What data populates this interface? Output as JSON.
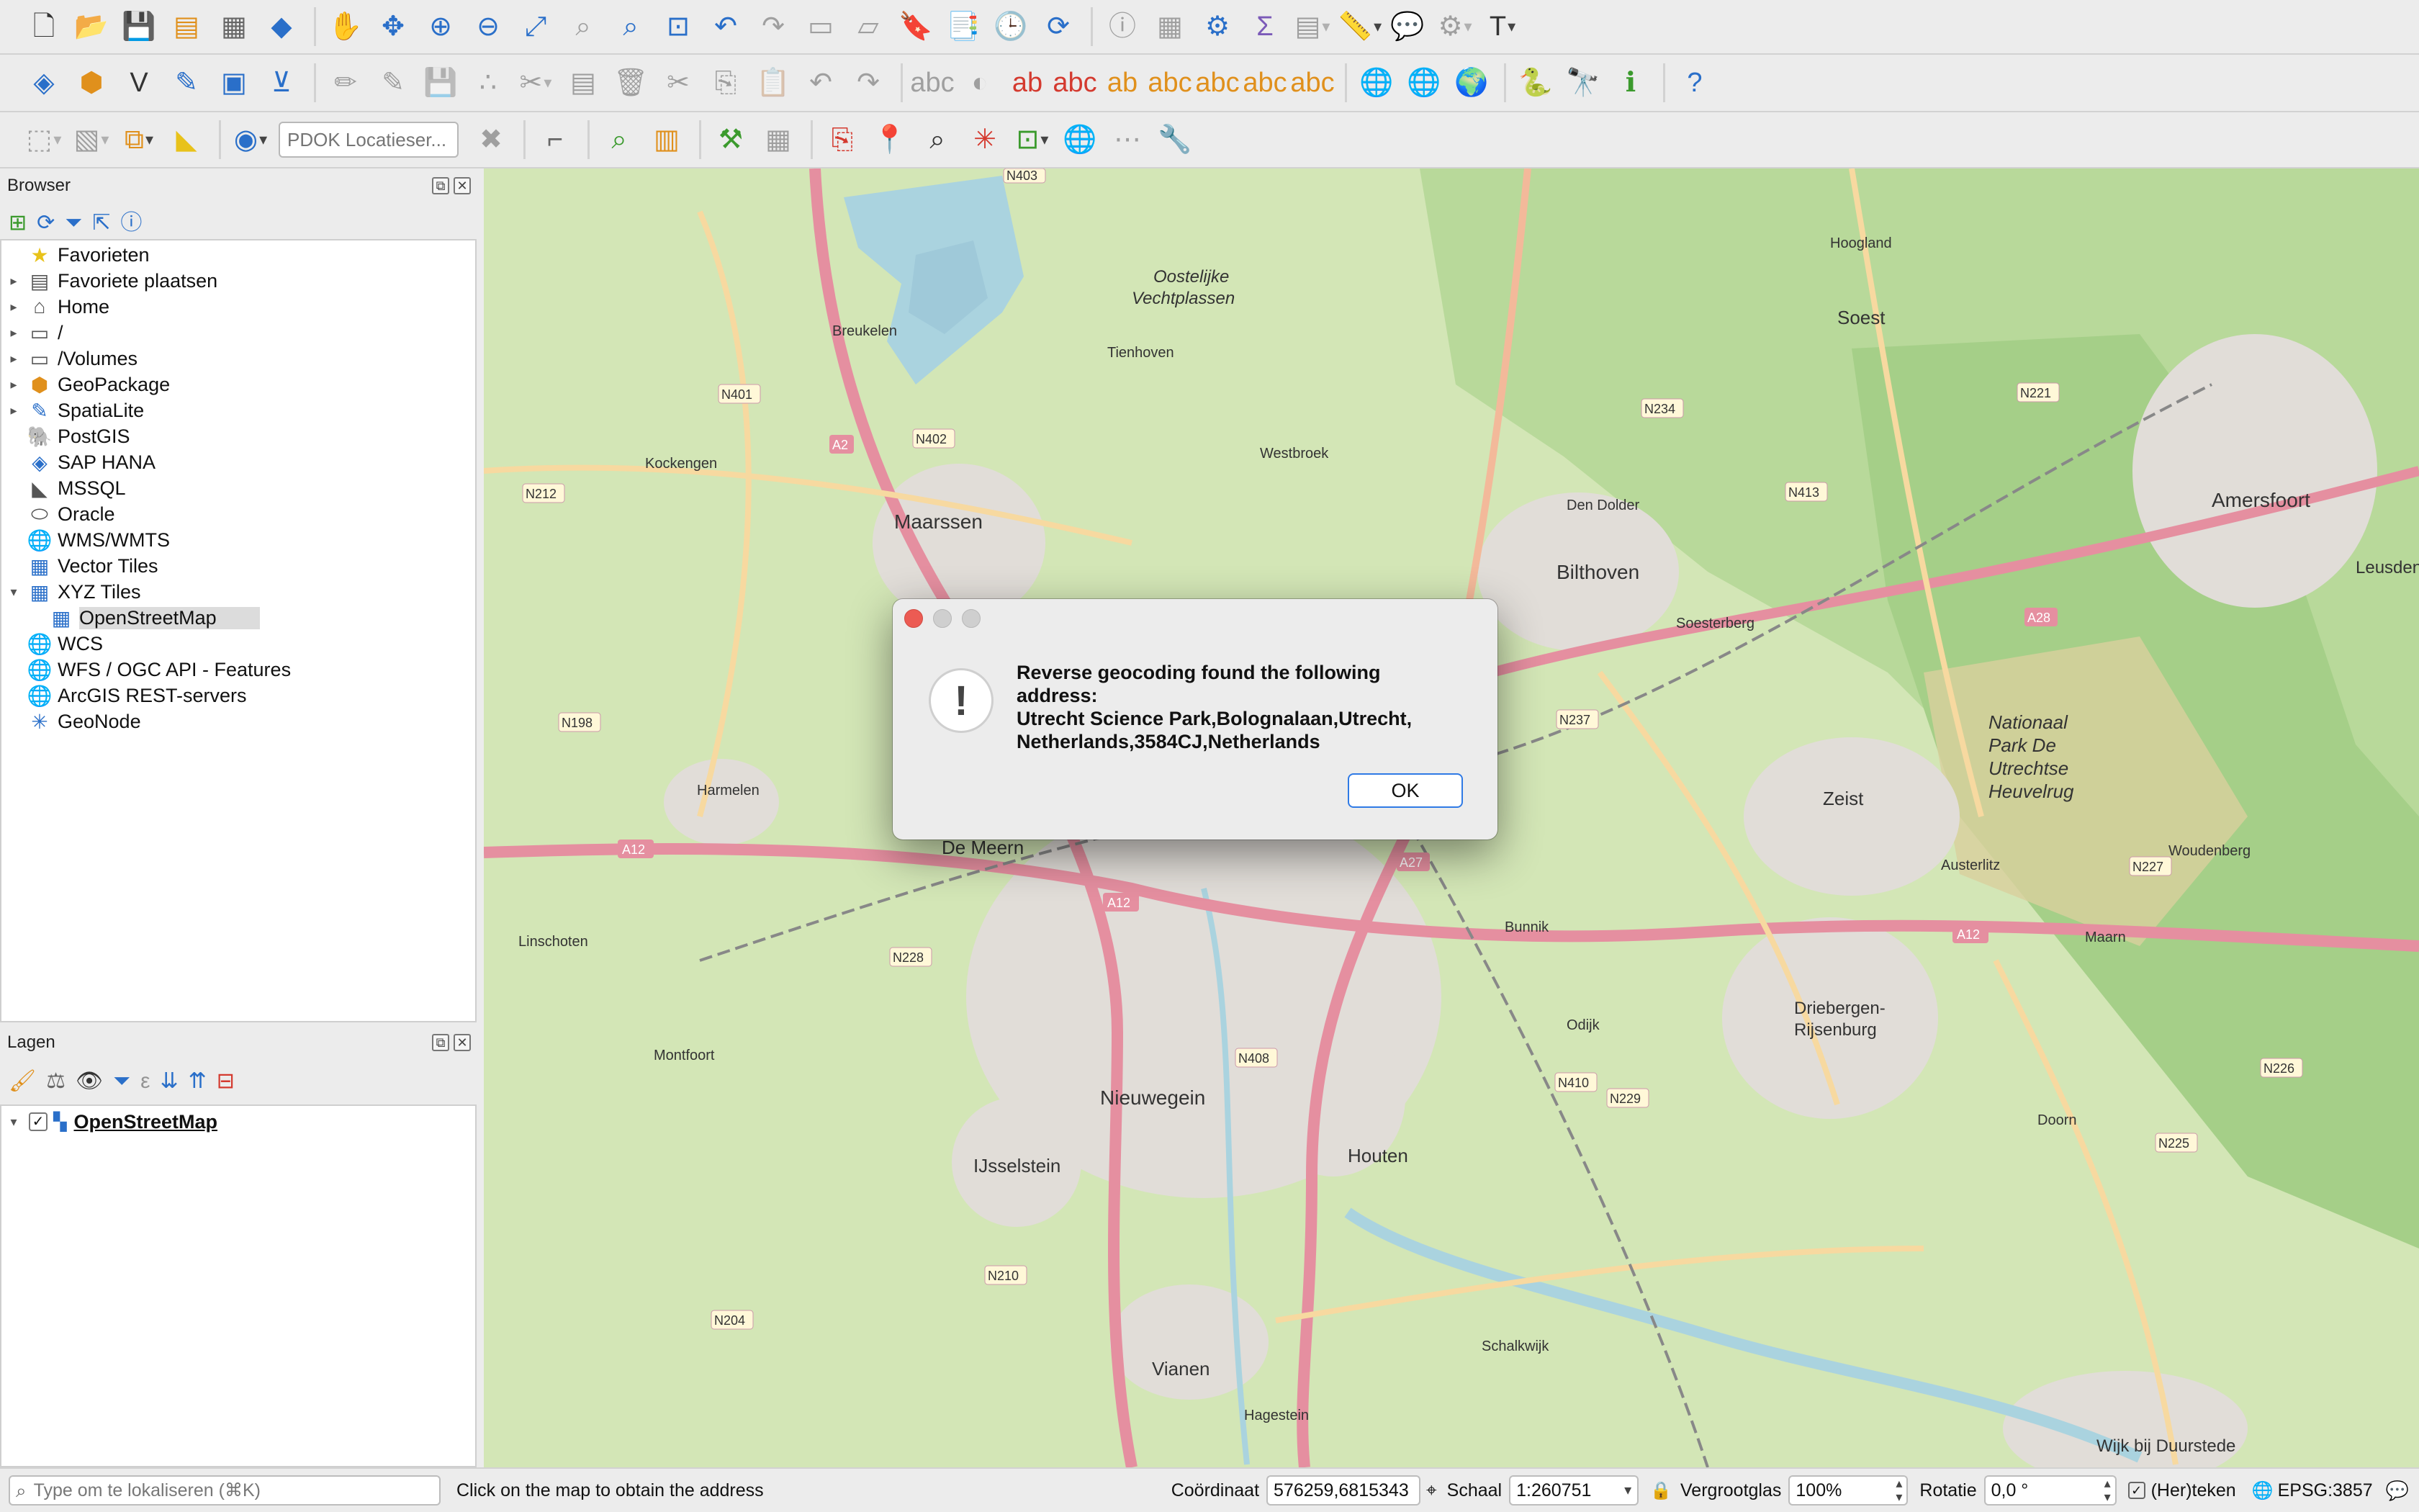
{
  "toolbar": {
    "pdok_placeholder": "PDOK Locatieser..."
  },
  "browser": {
    "title": "Browser",
    "items": [
      {
        "label": "Favorieten",
        "icon": "star-icon"
      },
      {
        "label": "Favoriete plaatsen",
        "icon": "bookmark-icon"
      },
      {
        "label": "Home",
        "icon": "home-icon"
      },
      {
        "label": "/",
        "icon": "folder-icon"
      },
      {
        "label": "/Volumes",
        "icon": "folder-icon"
      },
      {
        "label": "GeoPackage",
        "icon": "geopackage-icon"
      },
      {
        "label": "SpatiaLite",
        "icon": "spatialite-icon"
      },
      {
        "label": "PostGIS",
        "icon": "postgis-icon"
      },
      {
        "label": "SAP HANA",
        "icon": "sap-hana-icon"
      },
      {
        "label": "MSSQL",
        "icon": "mssql-icon"
      },
      {
        "label": "Oracle",
        "icon": "oracle-icon"
      },
      {
        "label": "WMS/WMTS",
        "icon": "globe-icon"
      },
      {
        "label": "Vector Tiles",
        "icon": "grid-icon"
      },
      {
        "label": "XYZ Tiles",
        "icon": "grid-icon"
      },
      {
        "label": "OpenStreetMap",
        "icon": "grid-icon"
      },
      {
        "label": "WCS",
        "icon": "globe-icon"
      },
      {
        "label": "WFS / OGC API - Features",
        "icon": "globe-icon"
      },
      {
        "label": "ArcGIS REST-servers",
        "icon": "globe-icon"
      },
      {
        "label": "GeoNode",
        "icon": "geonode-icon"
      }
    ]
  },
  "layers": {
    "title": "Lagen",
    "items": [
      {
        "label": "OpenStreetMap",
        "checked": true
      }
    ]
  },
  "dialog": {
    "message_l1": "Reverse geocoding found the following",
    "message_l2": "address:",
    "message_l3": "Utrecht Science Park,Bolognalaan,Utrecht,",
    "message_l4": "Netherlands,3584CJ,Netherlands",
    "ok_label": "OK"
  },
  "map": {
    "labels": {
      "maarssen": "Maarssen",
      "bilthoven": "Bilthoven",
      "amersfoort": "Amersfoort",
      "soest": "Soest",
      "zeist": "Zeist",
      "de_meern": "De Meern",
      "nieuwegein": "Nieuwegein",
      "houten": "Houten",
      "ijsselstein": "IJsselstein",
      "vianen": "Vianen",
      "leusden": "Leusden",
      "driebergen": "Driebergen-",
      "rijsenburg": "Rijsenburg",
      "wijk": "Wijk bij Duurstede",
      "breukelen": "Breukelen",
      "nationaal1": "Nationaal",
      "nationaal2": "Park De",
      "nationaal3": "Utrechtse",
      "nationaal4": "Heuvelrug",
      "vecht1": "Oostelijke",
      "vecht2": "Vechtplassen",
      "kockengen": "Kockengen",
      "harmelen": "Harmelen",
      "linschoten": "Linschoten",
      "montfoort": "Montfoort",
      "doorn": "Doorn",
      "maarn": "Maarn",
      "den_dolder": "Den Dolder",
      "soesterberg": "Soesterberg",
      "tienhoven": "Tienhoven",
      "westbroek": "Westbroek",
      "odijk": "Odijk",
      "bunnik": "Bunnik",
      "schalkwijk": "Schalkwijk",
      "hoogland": "Hoogland",
      "austerlitz": "Austerlitz",
      "woudenberg": "Woudenberg",
      "hagestein": "Hagestein",
      "a12": "A12",
      "a2": "A2",
      "a27": "A27",
      "a28": "A28",
      "n228": "N228",
      "n408": "N408",
      "n410": "N410",
      "n237": "N237",
      "n234": "N234",
      "n221": "N221",
      "n413": "N413",
      "n226": "N226",
      "n225": "N225",
      "n227": "N227",
      "n204": "N204",
      "n210": "N210",
      "n229": "N229",
      "n212": "N212",
      "n401": "N401",
      "n402": "N402",
      "n198": "N198",
      "n403": "N403"
    }
  },
  "status": {
    "search_placeholder": "Type om te lokaliseren (⌘K)",
    "message": "Click on the map to obtain the address",
    "coord_label": "Coördinaat",
    "coord_value": "576259,6815343",
    "scale_label": "Schaal",
    "scale_value": "1:260751",
    "magnifier_label": "Vergrootglas",
    "magnifier_value": "100%",
    "rotation_label": "Rotatie",
    "rotation_value": "0,0 °",
    "render_label": "(Her)teken",
    "crs_label": "EPSG:3857"
  }
}
